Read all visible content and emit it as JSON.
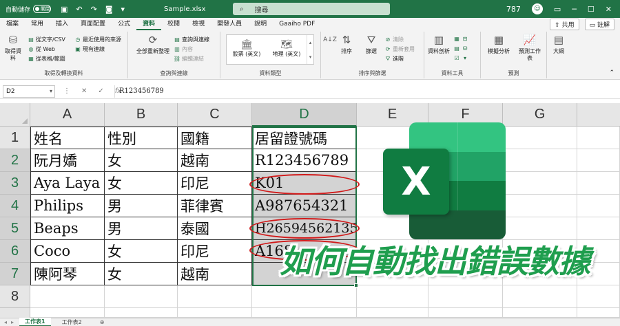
{
  "titlebar": {
    "autosave_label": "自動儲存",
    "autosave_state": "關閉",
    "filename": "Sample.xlsx",
    "search_placeholder": "搜尋",
    "user_number": "787"
  },
  "tabs": [
    "檔案",
    "常用",
    "插入",
    "頁面配置",
    "公式",
    "資料",
    "校閱",
    "檢視",
    "開發人員",
    "說明",
    "Gaaiho PDF"
  ],
  "active_tab": "資料",
  "share_label": "共用",
  "comments_label": "註解",
  "ribbon": {
    "get_data": "取得資料",
    "from_text_csv": "從文字/CSV",
    "from_web": "從 Web",
    "from_table": "從表格/範圍",
    "recent_sources": "最近使用的來源",
    "existing_connections": "現有連線",
    "group_get_transform": "取得及轉換資料",
    "refresh_all": "全部重新整理",
    "queries_connections": "查詢與連線",
    "properties": "內容",
    "edit_links": "編輯連結",
    "group_queries": "查詢與連線",
    "stocks": "股票 (英文)",
    "geography": "地理 (英文)",
    "group_data_types": "資料類型",
    "sort": "排序",
    "filter": "篩選",
    "clear": "清除",
    "reapply": "重新套用",
    "advanced": "進階",
    "group_sort_filter": "排序與篩選",
    "data_tools": "資料剖析",
    "group_data_tools": "資料工具",
    "what_if": "模擬分析",
    "forecast_sheet": "預測工作表",
    "group_forecast": "預測",
    "outline": "大綱"
  },
  "formula_bar": {
    "name_box": "D2",
    "formula": "R123456789"
  },
  "columns": [
    "A",
    "B",
    "C",
    "D",
    "E",
    "F",
    "G"
  ],
  "rows": [
    "1",
    "2",
    "3",
    "4",
    "5",
    "6",
    "7",
    "8"
  ],
  "table": [
    [
      "姓名",
      "性別",
      "國籍",
      "居留證號碼"
    ],
    [
      "阮月嬌",
      "女",
      "越南",
      "R123456789"
    ],
    [
      "Aya Laya",
      "女",
      "印尼",
      "K01"
    ],
    [
      "Philips",
      "男",
      "菲律賓",
      "A987654321"
    ],
    [
      "Beaps",
      "男",
      "泰國",
      "H26594562135"
    ],
    [
      "Coco",
      "女",
      "印尼",
      "A168"
    ],
    [
      "陳阿琴",
      "女",
      "越南",
      ""
    ]
  ],
  "logo_letter": "X",
  "headline": "如何自動找出錯誤數據",
  "sheets": [
    "工作表1",
    "工作表2"
  ],
  "colors": {
    "excel_green": "#217346",
    "error_circle": "#d11a1a",
    "headline": "#1f9e4e"
  }
}
